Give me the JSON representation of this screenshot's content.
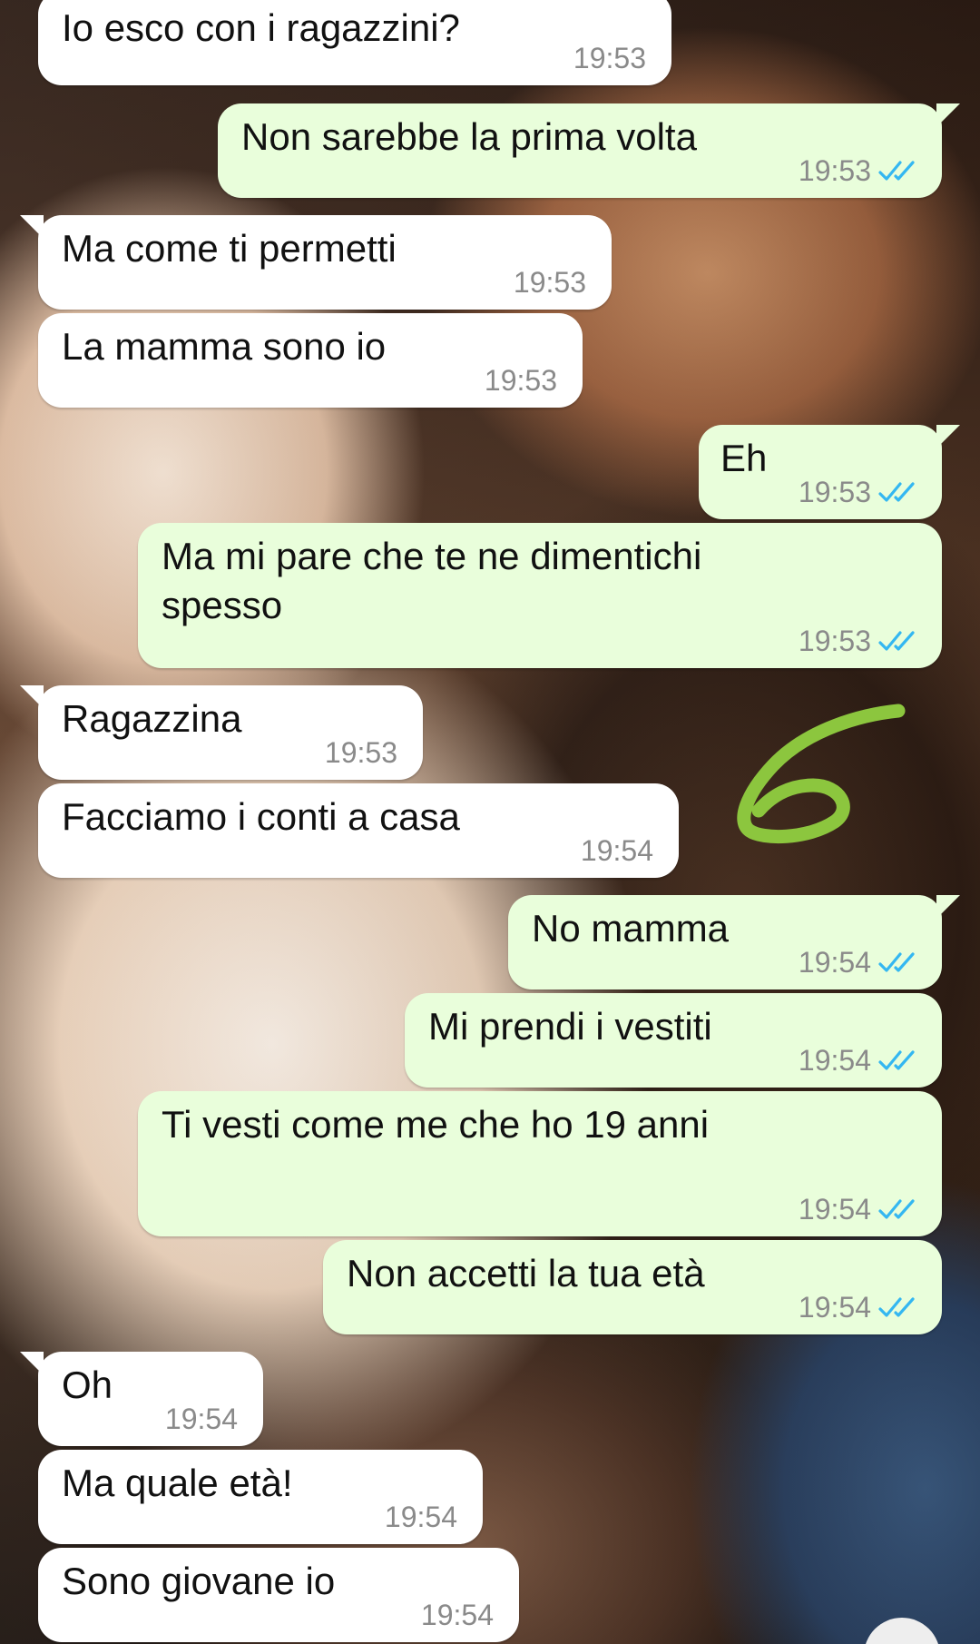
{
  "chat": {
    "messages": [
      {
        "text": "Io esco con i ragazzini?",
        "time": "19:53",
        "direction": "in"
      },
      {
        "text": "Non sarebbe la prima volta",
        "time": "19:53",
        "direction": "out",
        "status": "read"
      },
      {
        "text": "Ma come ti permetti",
        "time": "19:53",
        "direction": "in"
      },
      {
        "text": "La mamma sono io",
        "time": "19:53",
        "direction": "in"
      },
      {
        "text": "Eh",
        "time": "19:53",
        "direction": "out",
        "status": "read"
      },
      {
        "text": "Ma mi pare che te ne dimentichi\nspesso",
        "time": "19:53",
        "direction": "out",
        "status": "read"
      },
      {
        "text": "Ragazzina",
        "time": "19:53",
        "direction": "in"
      },
      {
        "text": "Facciamo i conti a casa",
        "time": "19:54",
        "direction": "in"
      },
      {
        "text": "No mamma",
        "time": "19:54",
        "direction": "out",
        "status": "read"
      },
      {
        "text": "Mi prendi i vestiti",
        "time": "19:54",
        "direction": "out",
        "status": "read"
      },
      {
        "text": "Ti vesti come me che ho 19 anni",
        "time": "19:54",
        "direction": "out",
        "status": "read"
      },
      {
        "text": "Non accetti la tua età",
        "time": "19:54",
        "direction": "out",
        "status": "read"
      },
      {
        "text": "Oh",
        "time": "19:54",
        "direction": "in"
      },
      {
        "text": "Ma quale età!",
        "time": "19:54",
        "direction": "in"
      },
      {
        "text": "Sono giovane io",
        "time": "19:54",
        "direction": "in"
      }
    ]
  },
  "annotation": {
    "icon": "handwritten-six-doodle",
    "color": "#8cc63e"
  },
  "colors": {
    "incoming_bubble": "#ffffff",
    "outgoing_bubble": "#e9fedb",
    "read_ticks": "#34b7f1",
    "timestamp": "#8a8a8a"
  }
}
